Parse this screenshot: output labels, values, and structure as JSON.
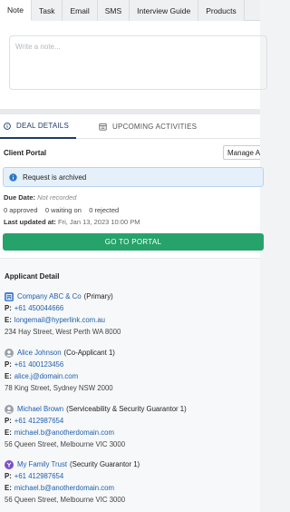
{
  "tabs": [
    {
      "label": "Note",
      "active": true
    },
    {
      "label": "Task"
    },
    {
      "label": "Email"
    },
    {
      "label": "SMS"
    },
    {
      "label": "Interview Guide"
    },
    {
      "label": "Products"
    }
  ],
  "note": {
    "placeholder": "Write a note..."
  },
  "sub_tabs": {
    "deal_details": "DEAL DETAILS",
    "upcoming_activities": "UPCOMING ACTIVITIES"
  },
  "client_portal": {
    "label": "Client Portal",
    "manage_button": "Manage A",
    "archived_message": "Request is archived",
    "due_date_label": "Due Date:",
    "due_date_value": "Not recorded",
    "approved": "0 approved",
    "waiting": "0 waiting on",
    "rejected": "0 rejected",
    "last_updated_label": "Last updated at:",
    "last_updated_value": "Fri, Jan 13, 2023 10:00 PM",
    "go_button": "GO TO PORTAL"
  },
  "applicant_detail": {
    "heading": "Applicant Detail",
    "applicants": [
      {
        "icon": "company-icon",
        "name": "Company ABC & Co",
        "role": "(Primary)",
        "phone": "+61 450044666",
        "email": "longemail@hyperlink.com.au",
        "address": "234 Hay Street, West Perth WA 8000"
      },
      {
        "icon": "person-icon",
        "name": "Alice Johnson",
        "role": "(Co-Applicant 1)",
        "phone": "+61 400123456",
        "email": "alice.j@domain.com",
        "address": "78 King Street, Sydney NSW 2000"
      },
      {
        "icon": "person-icon",
        "name": "Michael Brown",
        "role": "(Serviceability & Security Guarantor 1)",
        "phone": "+61 412987654",
        "email": "michael.b@anotherdomain.com",
        "address": "56 Queen Street, Melbourne VIC 3000"
      },
      {
        "icon": "trust-icon",
        "name": "My Family Trust",
        "role": "(Security Guarantor 1)",
        "phone": "+61 412987654",
        "email": "michael.b@anotherdomain.com",
        "address": "56 Queen Street, Melbourne VIC 3000"
      }
    ],
    "phone_label": "P:",
    "email_label": "E:"
  },
  "colors": {
    "accent_green": "#26a36b",
    "link_blue": "#1f5fae",
    "nav_active": "#1f3a68",
    "info_bg": "#e5f0fb"
  }
}
